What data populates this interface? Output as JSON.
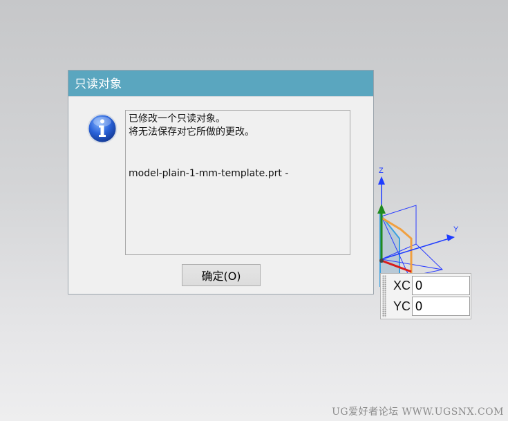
{
  "dialog": {
    "title": "只读对象",
    "icon": "info-icon",
    "message_lines": [
      "已修改一个只读对象。",
      "将无法保存对它所做的更改。"
    ],
    "filename": "model-plain-1-mm-template.prt -",
    "ok_label": "确定(O)"
  },
  "triad": {
    "z_label": "Z",
    "y_label": "Y"
  },
  "coords": {
    "xc_label": "XC",
    "xc_value": "0",
    "yc_label": "YC",
    "yc_value": "0"
  },
  "watermark": "UG爱好者论坛 WWW.UGSNX.COM",
  "colors": {
    "title_bar": "#5aa6bf",
    "axis_blue": "#1e3cff",
    "axis_green": "#1f8a1f",
    "axis_red": "#d81c1c",
    "plane_orange": "#f0a040",
    "plane_cyan": "#3aa0e0"
  }
}
